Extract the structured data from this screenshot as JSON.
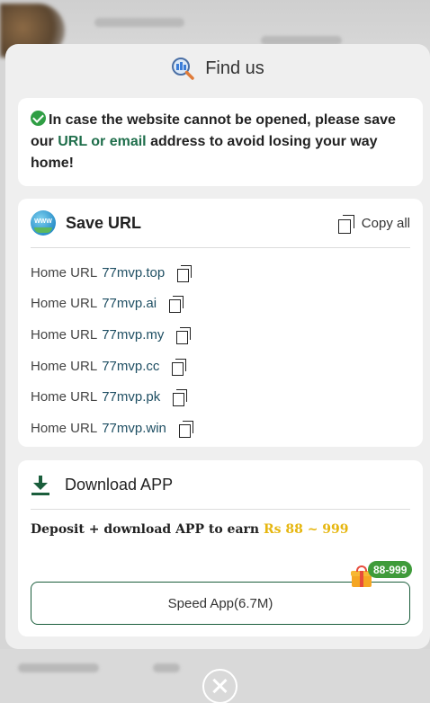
{
  "modal": {
    "title": "Find us",
    "notice": {
      "part1": "In case the website cannot be opened, please save our ",
      "highlight": "URL or email",
      "part2": " address to avoid losing your way home!"
    },
    "save_url": {
      "title": "Save URL",
      "copy_all_label": "Copy all",
      "items": [
        {
          "label": "Home URL",
          "value": "77mvp.top"
        },
        {
          "label": "Home URL",
          "value": "77mvp.ai"
        },
        {
          "label": "Home URL",
          "value": "77mvp.my"
        },
        {
          "label": "Home URL",
          "value": "77mvp.cc"
        },
        {
          "label": "Home URL",
          "value": "77mvp.pk"
        },
        {
          "label": "Home URL",
          "value": "77mvp.win"
        }
      ]
    },
    "download": {
      "title": "Download APP",
      "deposit_text": "Deposit + download APP to earn ",
      "deposit_amount": "Rs 88 ~ 999",
      "badge": "88-999",
      "button_label": "Speed App(6.7M)"
    }
  },
  "icons": {
    "header": "search-globe-icon",
    "check": "check-circle-icon",
    "www": "www-globe-icon",
    "copy": "copy-icon",
    "download": "download-icon",
    "gift": "gift-icon",
    "close": "close-icon"
  },
  "colors": {
    "accent_green": "#1b5e3c",
    "link_green": "#1f6e4b",
    "amount_gold": "#e6b60f",
    "badge_green": "#3f9b3a"
  }
}
